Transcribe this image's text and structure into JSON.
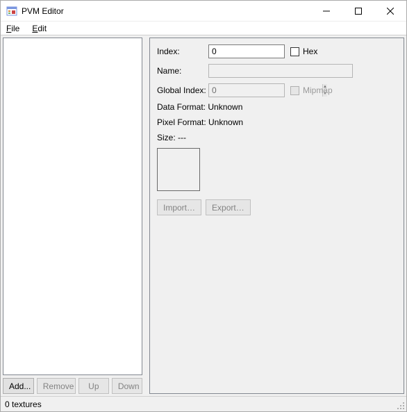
{
  "window": {
    "title": "PVM Editor"
  },
  "menu": {
    "file": "File",
    "edit": "Edit"
  },
  "list_buttons": {
    "add": "Add...",
    "remove": "Remove",
    "up": "Up",
    "down": "Down"
  },
  "labels": {
    "index": "Index:",
    "name": "Name:",
    "global_index": "Global Index:",
    "hex": "Hex",
    "mipmap": "Mipmap",
    "data_format_prefix": "Data Format: ",
    "pixel_format_prefix": "Pixel Format: ",
    "size_prefix": "Size: "
  },
  "fields": {
    "index": "0",
    "name": "",
    "global_index": "0",
    "hex_checked": false,
    "mipmap_checked": false,
    "data_format": "Unknown",
    "pixel_format": "Unknown",
    "size": "---"
  },
  "io_buttons": {
    "import": "Import…",
    "export": "Export…"
  },
  "status": {
    "text": "0 textures"
  }
}
